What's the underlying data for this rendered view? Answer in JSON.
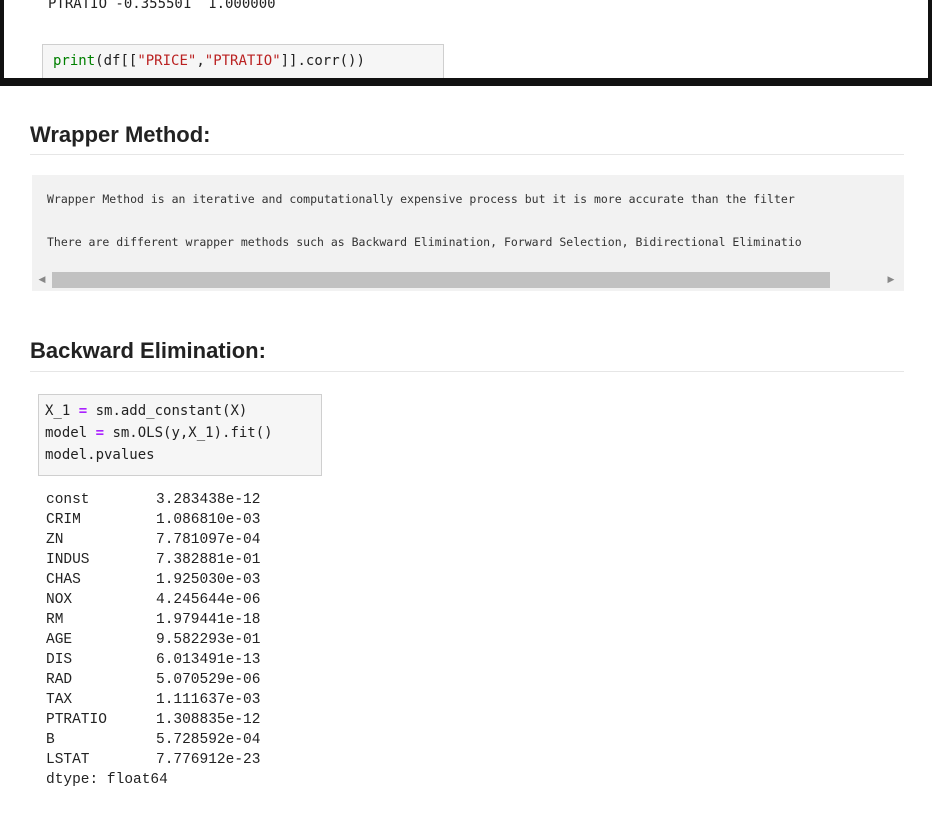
{
  "previous_output": "PTRATIO -0.355501  1.000000",
  "top_cell": {
    "tokens": [
      {
        "t": "print",
        "c": "tok-fn"
      },
      {
        "t": "(df[[",
        "c": "tok-punc"
      },
      {
        "t": "\"PRICE\"",
        "c": "tok-str"
      },
      {
        "t": ",",
        "c": "tok-punc"
      },
      {
        "t": "\"PTRATIO\"",
        "c": "tok-str"
      },
      {
        "t": "]].corr())",
        "c": "tok-punc"
      }
    ]
  },
  "wrapper": {
    "heading": "Wrapper Method:",
    "line1": "Wrapper Method is an iterative and computationally expensive process but it is more accurate than the filter",
    "line2": "There are different wrapper methods such as Backward Elimination, Forward Selection, Bidirectional Eliminatio"
  },
  "backward": {
    "heading": "Backward Elimination:",
    "code": [
      [
        {
          "t": "X_1 ",
          "c": "pln"
        },
        {
          "t": "=",
          "c": "op"
        },
        {
          "t": " sm.add_constant(X)",
          "c": "pln"
        }
      ],
      [
        {
          "t": "model ",
          "c": "pln"
        },
        {
          "t": "=",
          "c": "op"
        },
        {
          "t": " sm.OLS(y,X_1).fit()",
          "c": "pln"
        }
      ],
      [
        {
          "t": "model.pvalues",
          "c": "pln"
        }
      ]
    ]
  },
  "pvalues": [
    {
      "name": "const",
      "value": "3.283438e-12"
    },
    {
      "name": "CRIM",
      "value": "1.086810e-03"
    },
    {
      "name": "ZN",
      "value": "7.781097e-04"
    },
    {
      "name": "INDUS",
      "value": "7.382881e-01"
    },
    {
      "name": "CHAS",
      "value": "1.925030e-03"
    },
    {
      "name": "NOX",
      "value": "4.245644e-06"
    },
    {
      "name": "RM",
      "value": "1.979441e-18"
    },
    {
      "name": "AGE",
      "value": "9.582293e-01"
    },
    {
      "name": "DIS",
      "value": "6.013491e-13"
    },
    {
      "name": "RAD",
      "value": "5.070529e-06"
    },
    {
      "name": "TAX",
      "value": "1.111637e-03"
    },
    {
      "name": "PTRATIO",
      "value": "1.308835e-12"
    },
    {
      "name": "B",
      "value": "5.728592e-04"
    },
    {
      "name": "LSTAT",
      "value": "7.776912e-23"
    }
  ],
  "dtype": "dtype: float64"
}
